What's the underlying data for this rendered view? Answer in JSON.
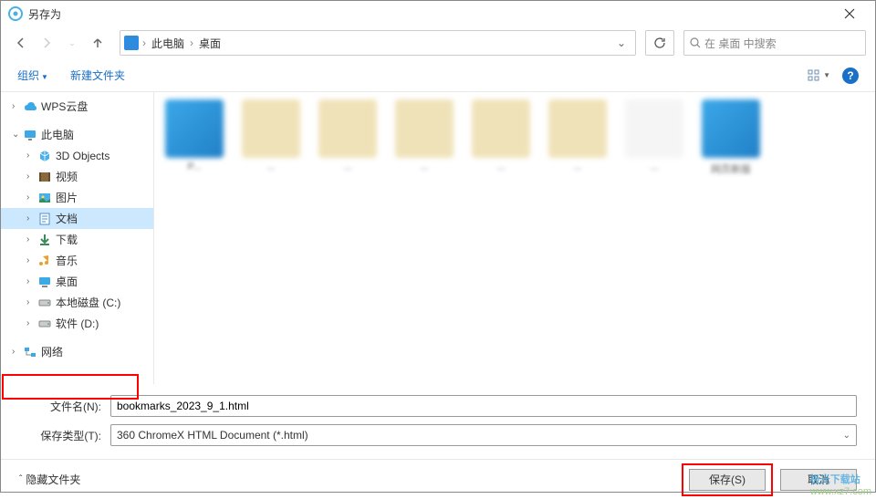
{
  "title": "另存为",
  "nav": {
    "back": "←",
    "forward": "→",
    "up": "↑"
  },
  "address": {
    "crumbs": [
      "此电脑",
      "桌面"
    ],
    "dropdown": "⌄"
  },
  "search": {
    "placeholder": "在 桌面 中搜索"
  },
  "toolbar": {
    "organize": "组织",
    "new_folder": "新建文件夹"
  },
  "sidebar": {
    "items": [
      {
        "level": 1,
        "expand": "›",
        "icon": "cloud",
        "label": "WPS云盘",
        "selected": false
      },
      {
        "level": 1,
        "expand": "⌄",
        "icon": "pc",
        "label": "此电脑",
        "selected": false
      },
      {
        "level": 2,
        "expand": "›",
        "icon": "3d",
        "label": "3D Objects",
        "selected": false
      },
      {
        "level": 2,
        "expand": "›",
        "icon": "video",
        "label": "视频",
        "selected": false
      },
      {
        "level": 2,
        "expand": "›",
        "icon": "pic",
        "label": "图片",
        "selected": false
      },
      {
        "level": 2,
        "expand": "›",
        "icon": "doc",
        "label": "文档",
        "selected": true
      },
      {
        "level": 2,
        "expand": "›",
        "icon": "dl",
        "label": "下载",
        "selected": false
      },
      {
        "level": 2,
        "expand": "›",
        "icon": "music",
        "label": "音乐",
        "selected": false
      },
      {
        "level": 2,
        "expand": "›",
        "icon": "desk",
        "label": "桌面",
        "selected": false,
        "redbox": true
      },
      {
        "level": 2,
        "expand": "›",
        "icon": "disk",
        "label": "本地磁盘 (C:)",
        "selected": false
      },
      {
        "level": 2,
        "expand": "›",
        "icon": "disk",
        "label": "软件 (D:)",
        "selected": false
      },
      {
        "level": 1,
        "expand": "›",
        "icon": "net",
        "label": "网络",
        "selected": false
      }
    ]
  },
  "files": [
    {
      "type": "blue",
      "label": "P..."
    },
    {
      "type": "folder",
      "label": "..."
    },
    {
      "type": "folder",
      "label": "..."
    },
    {
      "type": "folder",
      "label": "..."
    },
    {
      "type": "folder",
      "label": "..."
    },
    {
      "type": "folder",
      "label": "..."
    },
    {
      "type": "white",
      "label": "..."
    },
    {
      "type": "blue",
      "label": "网页新版"
    }
  ],
  "form": {
    "filename_label": "文件名(N):",
    "filename_value": "bookmarks_2023_9_1.html",
    "filetype_label": "保存类型(T):",
    "filetype_value": "360 ChromeX HTML Document (*.html)"
  },
  "footer": {
    "hide_folders": "隐藏文件夹",
    "save": "保存(S)",
    "cancel": "取消"
  },
  "watermark": {
    "line1": "极光下载站",
    "line2": "www.xz7.com"
  }
}
